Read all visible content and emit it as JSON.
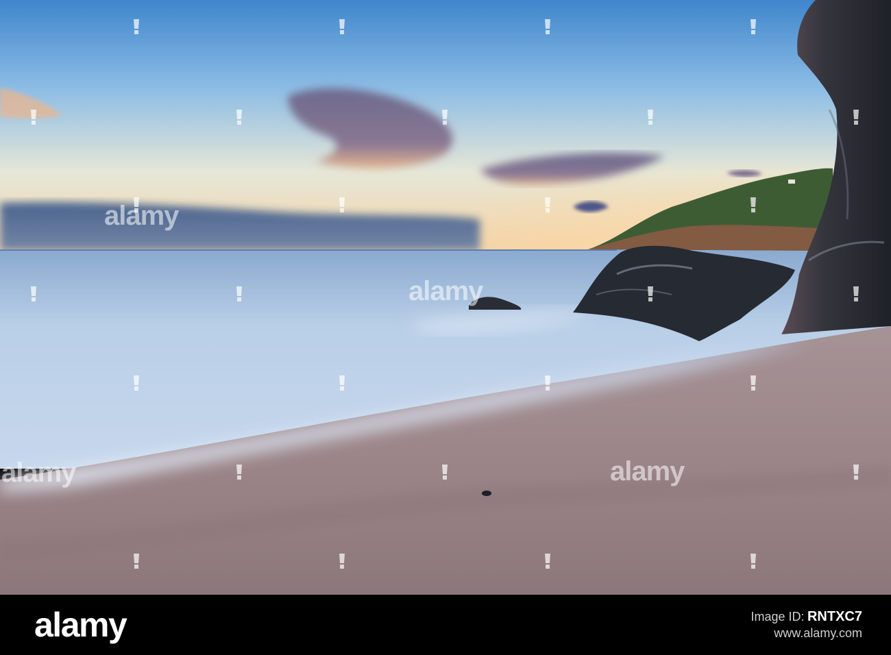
{
  "image": {
    "scene": "Long-exposure beach at sunset with smooth misty sea, dark rocks and a headland",
    "colors": {
      "sky_top": "#5c9ad3",
      "sky_horizon": "#f3d3a4",
      "sea": "#b6cde6",
      "sand": "#a38e90",
      "rock": "#2b2e36",
      "headland_green": "#3d5a34"
    }
  },
  "watermark": {
    "text": "alamy",
    "icon": "alamy-mark-icon"
  },
  "footer": {
    "brand": "alamy",
    "image_id_label": "Image ID:",
    "image_id": "RNTXC7",
    "site": "www.alamy.com"
  }
}
